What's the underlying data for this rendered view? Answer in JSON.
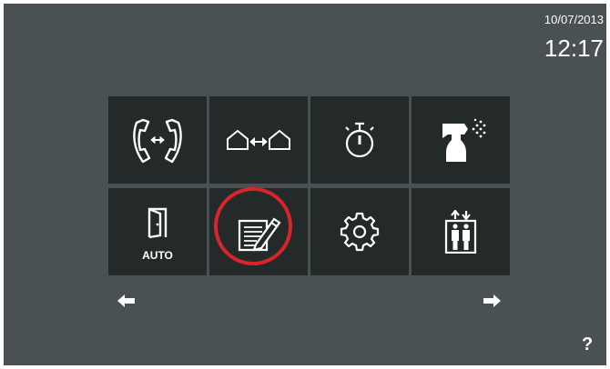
{
  "status": {
    "date": "10/07/2013",
    "time": "12:17"
  },
  "menu": {
    "tiles": [
      {
        "icon": "intercom-call-icon"
      },
      {
        "icon": "house-to-house-icon"
      },
      {
        "icon": "stopwatch-icon"
      },
      {
        "icon": "spray-bottle-icon"
      },
      {
        "icon": "door-auto-icon",
        "label": "AUTO"
      },
      {
        "icon": "notepad-pencil-icon",
        "highlighted": true
      },
      {
        "icon": "gear-icon"
      },
      {
        "icon": "elevator-icon"
      }
    ]
  },
  "nav": {
    "prev_icon": "arrow-left-icon",
    "next_icon": "arrow-right-icon",
    "help": "?"
  },
  "colors": {
    "background": "#4a5152",
    "tile": "#242a2a",
    "highlight": "#d8242a",
    "foreground": "#ffffff"
  }
}
